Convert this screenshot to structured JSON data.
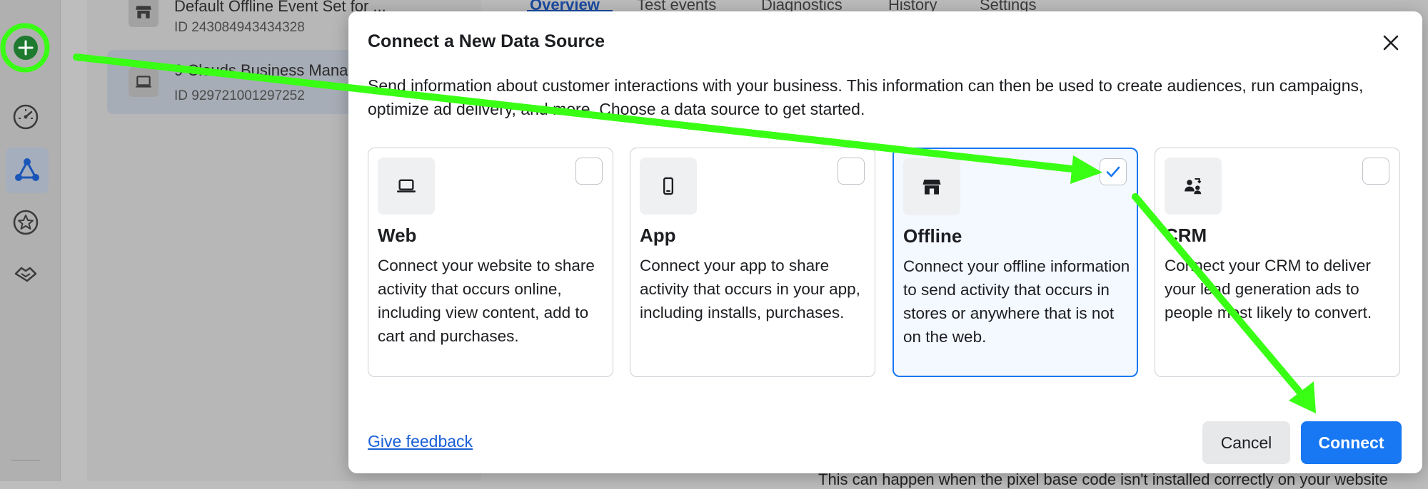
{
  "background": {
    "list": [
      {
        "title": "Default Offline Event Set for ...",
        "id": "ID 243084943434328"
      },
      {
        "title": "9 Clouds Business Mana",
        "id": "ID 929721001297252"
      }
    ],
    "tabs": [
      "Overview",
      "Test events",
      "Diagnostics",
      "History",
      "Settings"
    ],
    "bottom_text": "This can happen when the pixel base code isn't installed correctly on your website"
  },
  "left_nav": {
    "items": [
      {
        "name": "add",
        "icon": "plus-circle-icon"
      },
      {
        "name": "overview",
        "icon": "gauge-icon"
      },
      {
        "name": "data-sources",
        "icon": "network-icon"
      },
      {
        "name": "custom-conversions",
        "icon": "star-circle-icon"
      },
      {
        "name": "partner-integrations",
        "icon": "handshake-icon"
      }
    ]
  },
  "modal": {
    "title": "Connect a New Data Source",
    "description": "Send information about customer interactions with your business. This information can then be used to create audiences, run campaigns, optimize ad delivery, and more. Choose a data source to get started.",
    "cards": [
      {
        "title": "Web",
        "desc": "Connect your website to share activity that occurs online, including view content, add to cart and purchases.",
        "icon": "laptop-icon",
        "checked": false
      },
      {
        "title": "App",
        "desc": "Connect your app to share activity that occurs in your app, including installs, purchases.",
        "icon": "phone-icon",
        "checked": false
      },
      {
        "title": "Offline",
        "desc": "Connect your offline information to send activity that occurs in stores or anywhere that is not on the web.",
        "icon": "storefront-icon",
        "checked": true
      },
      {
        "title": "CRM",
        "desc": "Connect your CRM to deliver your lead generation ads to people most likely to convert.",
        "icon": "people-sync-icon",
        "checked": false
      }
    ],
    "feedback_link": "Give feedback",
    "cancel_label": "Cancel",
    "connect_label": "Connect"
  },
  "colors": {
    "primary": "#1877f2",
    "annotation": "#39ff14",
    "link": "#1a5fd6"
  }
}
